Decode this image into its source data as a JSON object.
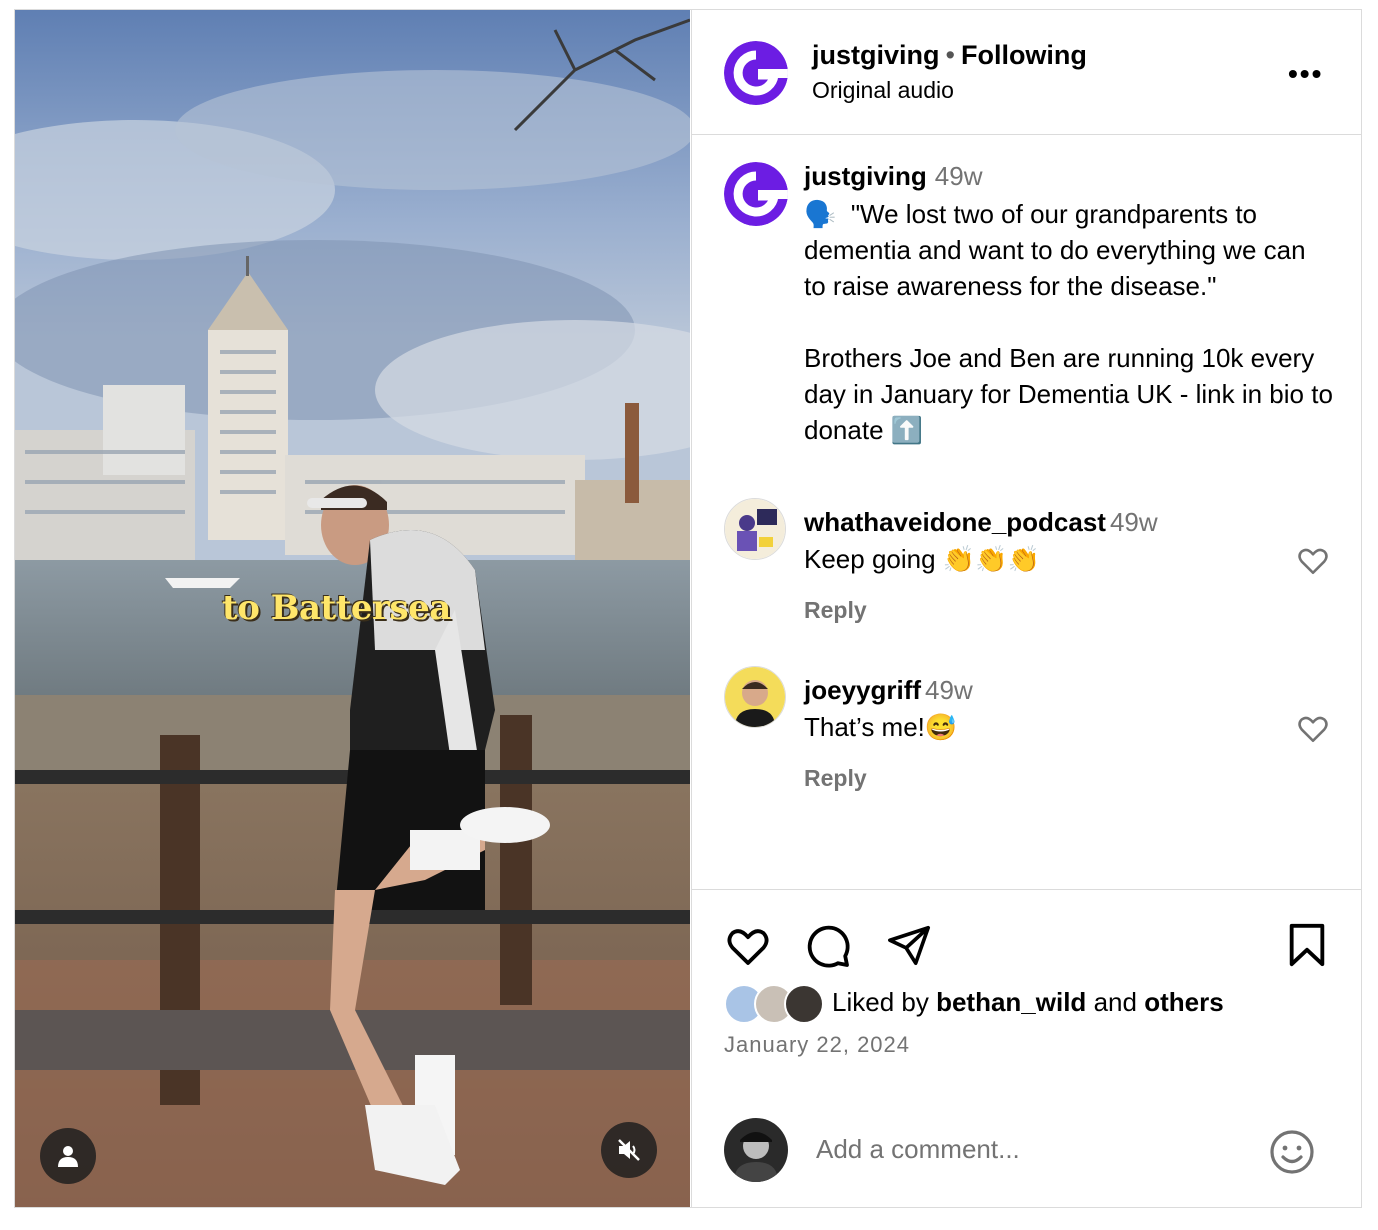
{
  "media": {
    "overlay_text": "to Battersea",
    "user_tag_icon": "person-icon",
    "mute_icon": "speaker-muted-icon"
  },
  "header": {
    "username": "justgiving",
    "separator": "•",
    "follow_status": "Following",
    "audio_label": "Original audio",
    "more_label": "•••"
  },
  "caption": {
    "username": "justgiving",
    "time": "49w",
    "emoji_lead": "🗣️",
    "paragraph1": "\"We lost two of our grandparents to dementia and want to do everything we can to raise awareness for the disease.\"",
    "paragraph2": "Brothers Joe and Ben are running 10k every day in January for Dementia UK - link in bio to donate",
    "emoji_tail": "⬆️"
  },
  "comments": [
    {
      "username": "whathaveidone_podcast",
      "time": "49w",
      "text": "Keep going 👏👏👏",
      "reply_label": "Reply"
    },
    {
      "username": "joeyygriff",
      "time": "49w",
      "text": "That’s me!😅",
      "reply_label": "Reply"
    }
  ],
  "actions": {
    "liked_prefix": "Liked by",
    "liked_user": "bethan_wild",
    "liked_and": "and",
    "liked_others": "others",
    "date": "January 22, 2024"
  },
  "composer": {
    "placeholder": "Add a comment..."
  },
  "colors": {
    "brand_purple": "#6c1de3",
    "border": "#dbdbdb",
    "muted_text": "#737373"
  }
}
